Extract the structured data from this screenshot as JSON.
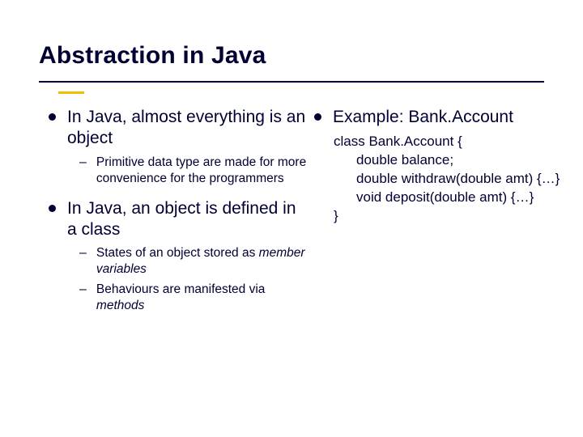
{
  "title": "Abstraction in Java",
  "left": {
    "item1": "In Java, almost everything is an object",
    "item1_sub1": "Primitive data type are made for more convenience for the programmers",
    "item2": "In Java, an object is defined in a class",
    "item2_sub1_a": "States of an object stored as ",
    "item2_sub1_b": "member variables",
    "item2_sub2_a": "Behaviours are manifested via ",
    "item2_sub2_b": "methods"
  },
  "right": {
    "heading": "Example: Bank.Account",
    "code": {
      "l1": "class Bank.Account {",
      "l2": "double balance;",
      "l3": "double withdraw(double amt) {…}",
      "l4": "void deposit(double amt) {…}",
      "l5": "}"
    }
  }
}
